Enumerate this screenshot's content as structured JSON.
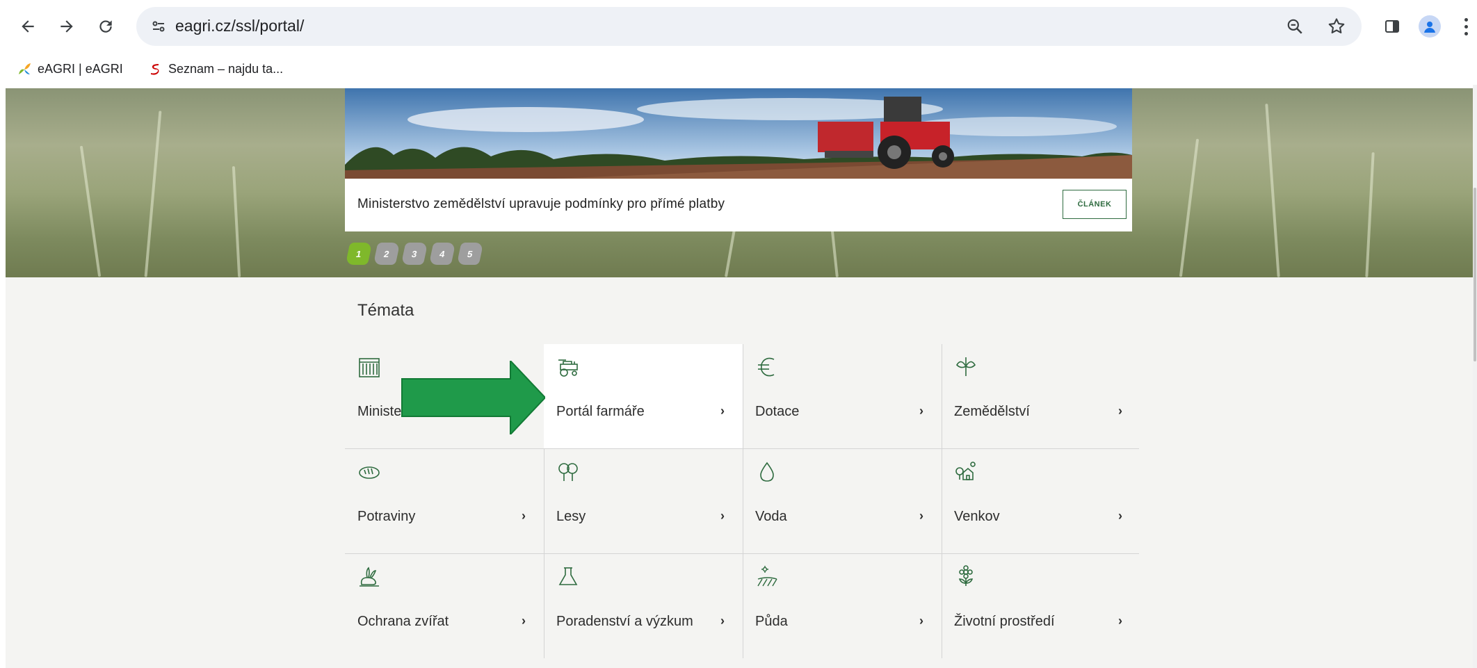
{
  "browser": {
    "url": "eagri.cz/ssl/portal/",
    "back_icon": "back-arrow-icon",
    "forward_icon": "forward-arrow-icon",
    "reload_icon": "reload-icon",
    "bookmarks": [
      {
        "label": "eAGRI | eAGRI",
        "icon": "eagri-favicon"
      },
      {
        "label": "Seznam – najdu ta...",
        "icon": "seznam-favicon"
      }
    ]
  },
  "hero": {
    "caption": "Ministerstvo zemědělství upravuje podmínky pro přímé platby",
    "button_label": "ČLÁNEK",
    "slides": [
      "1",
      "2",
      "3",
      "4",
      "5"
    ],
    "active_slide": "1"
  },
  "topics": {
    "title": "Témata",
    "items": [
      {
        "label": "Ministerstvo",
        "icon": "building-icon"
      },
      {
        "label": "Portál farmáře",
        "icon": "tractor-icon"
      },
      {
        "label": "Dotace",
        "icon": "euro-icon"
      },
      {
        "label": "Zemědělství",
        "icon": "plant-icon"
      },
      {
        "label": "Potraviny",
        "icon": "bread-icon"
      },
      {
        "label": "Lesy",
        "icon": "trees-icon"
      },
      {
        "label": "Voda",
        "icon": "water-drop-icon"
      },
      {
        "label": "Venkov",
        "icon": "village-icon"
      },
      {
        "label": "Ochrana zvířat",
        "icon": "rabbit-icon"
      },
      {
        "label": "Poradenství a výzkum",
        "icon": "flask-icon"
      },
      {
        "label": "Půda",
        "icon": "field-icon"
      },
      {
        "label": "Životní prostředí",
        "icon": "flower-icon"
      }
    ],
    "arrow": "›"
  },
  "colors": {
    "brand_green": "#2e6b3f",
    "active_dot": "#7fb82b",
    "annotation_arrow": "#1f9a4a"
  }
}
